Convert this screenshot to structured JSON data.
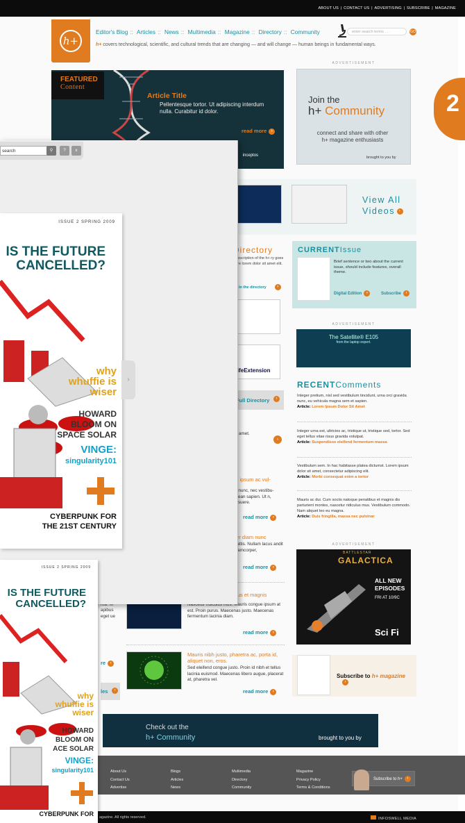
{
  "topbar": {
    "links": [
      "ABOUT US",
      "CONTACT US",
      "ADVERTISING",
      "SUBSCRIBE",
      "MAGAZINE"
    ]
  },
  "logo": {
    "text": "h+"
  },
  "nav": {
    "items": [
      "Editor's Blog",
      "Articles",
      "News",
      "Multimedia",
      "Magazine",
      "Directory",
      "Community"
    ],
    "separator": "::"
  },
  "search": {
    "placeholder": "enter search terms . . .",
    "go": "GO"
  },
  "tagline": {
    "brand": "h+",
    "text": "covers technological, scientific, and cultural trends that are changing — and will change — human beings in fundamental ways."
  },
  "featured": {
    "label1": "FEATURED",
    "label2": "Content",
    "title": "Article Title",
    "text": "Pellentesque tortor. Ut adipiscing interdum nulla. Curabitur id dolor.",
    "readmore": "read more",
    "tab1": "ia",
    "tab2": "inceptos"
  },
  "ad1": {
    "label": "ADVERTISEMENT",
    "join": "Join the",
    "brand": "h+",
    "community": "Community",
    "text": "connect and share with other",
    "text2": "h+ magazine enthusiasts",
    "brought": "brought to you by"
  },
  "badge": {
    "number": "2"
  },
  "videos": {
    "viewall1": "View All",
    "viewall2": "Videos"
  },
  "directory": {
    "title": "Directory",
    "text": "t description of the h+ ry goes here lorem dolor sit amet elit.",
    "link": "ed in the directory",
    "logo2": "LifeExtension",
    "full": "Full Directory"
  },
  "current": {
    "title1": "CURRENT",
    "title2": "Issue",
    "text": "Brief sentence or two about the current issue, should include features, overall theme.",
    "digital": "Digital Edition",
    "subscribe": "Subscribe"
  },
  "ad2": {
    "label": "ADVERTISEMENT",
    "text": "The Satellite® E105",
    "sub": "from the laptop expert."
  },
  "recent": {
    "title1": "RECENT",
    "title2": "Comments",
    "comments": [
      {
        "text": "Integer pretium, nisl sed vestibulum tincidunt, urna orci gravida nunc, eu vehicula magna sem et sapien.",
        "article": "Article:",
        "link": "Lorem Ipsum Dolor Sit Amet"
      },
      {
        "text": "Integer urna est, ultricies ac, tristique ut, tristique sed, tortor. Sed eget tellus vitae risus gravida volutpat.",
        "article": "Article:",
        "link": "Suspendisse eleifend fermentum massa"
      },
      {
        "text": "Vestibulum sem. In hac habitasse platea dictumst. Lorem ipsum dolor sit amet, consectetur adipiscing elit.",
        "article": "Article:",
        "link": "Morbi consequat enim a tortor"
      },
      {
        "text": "Mauris ac dui. Cum sociis natoque penatibus et magnis dis parturient montes, nascetur ridiculus mus. Vestibulum commodo. Nam aliquet leo eu magna.",
        "article": "Article:",
        "link": "Duis fringilla, massa nec pulvinar"
      }
    ]
  },
  "ad3": {
    "label": "ADVERTISEMENT",
    "title": "GALACTICA",
    "pre": "BATTLESTAR",
    "ne1": "ALL NEW",
    "ne2": "EPISODES",
    "fri": "FRI AT 10/9C",
    "sci": "Sci Fi"
  },
  "subscribe": {
    "text": "Subscribe to",
    "brand": "h+ magazine"
  },
  "articles": [
    {
      "frag": "sit amet."
    },
    {
      "head": "is, ipsum ac vul-",
      "body": "ur nunc, nec vestibu- enean sapien. Ut n, posuere.",
      "rm": "read more"
    },
    {
      "head": "per diam nunc",
      "body": "mattis. Nullam lacus andit ullamcorper,",
      "rm": "read more"
    },
    {
      "head": "ibus et magnis",
      "body": "Nascetur ridiculus mus. Mauris congue ipsum at est. Proin purus. Maecenas justo. Maecenas fermentum lacinia diam.",
      "rm": "read more"
    },
    {
      "head": "Mauris nibh justo, pharetra ac, porta id, aliquet non, eros.",
      "body": "Sed eleifend congue justo. Proin id nibh et tellus lacinia euismod. Maecenas libero augue, placerat at, pharetra vel.",
      "rm": "read more"
    },
    {
      "frag": ", eget nisi. In apibus eget ue",
      "rm": "re",
      "les": "les"
    }
  ],
  "commbanner": {
    "check": "Check out the",
    "brand": "h+",
    "community": "Community",
    "brought": "brought to you by"
  },
  "footer": {
    "cols": [
      [
        "About Us",
        "Contact Us",
        "Advertise"
      ],
      [
        "Blogs",
        "Articles",
        "News"
      ],
      [
        "Multimedia",
        "Directory",
        "Community"
      ],
      [
        "Magazine",
        "Privacy Policy",
        "Terms & Conditions"
      ]
    ],
    "subscribe": "Subscribe to h+"
  },
  "bottom": {
    "copyright": "agazine. All rights reserved.",
    "right": "INFOSWELL MEDIA"
  },
  "viewer": {
    "search_value": "search",
    "btn_q": "?",
    "btn_x": "x",
    "cover": {
      "issue": "ISSUE 2 SPRING 2009",
      "h1a": "IS THE FUTURE",
      "h1b": "CANCELLED?",
      "why1": "why",
      "why2": "whuffie is",
      "why3": "wiser",
      "hb1": "HOWARD",
      "hb2": "BLOOM ON",
      "hb3": "SPACE SOLAR",
      "vg1": "VINGE:",
      "vg2": "singularity101",
      "cp1": "CYBERPUNK FOR",
      "cp2": "THE 21ST CENTURY"
    },
    "cover2": {
      "issue": "ISSUE 2 SPRING 2009",
      "h1a": "IS THE FUTURE",
      "h1b": "CANCELLED?",
      "why1": "why",
      "why2": "whuffie is",
      "why3": "wiser",
      "hb1": "HOWARD",
      "hb2": "BLOOM ON",
      "hb3": "ACE SOLAR",
      "vg1": "VINGE:",
      "vg2": "singularity101",
      "cp1": "CYBERPUNK FOR"
    }
  }
}
